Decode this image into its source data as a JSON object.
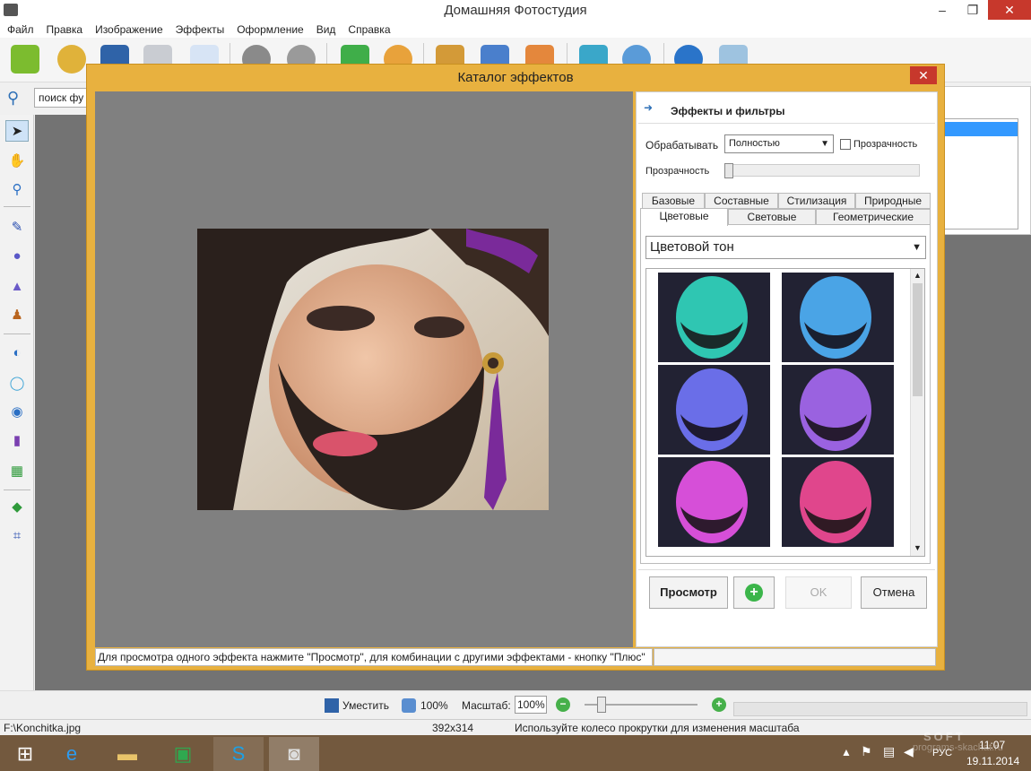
{
  "window": {
    "title": "Домашняя Фотостудия",
    "minimize": "–",
    "restore": "❐",
    "close": "✕"
  },
  "menu": [
    "Файл",
    "Правка",
    "Изображение",
    "Эффекты",
    "Оформление",
    "Вид",
    "Справка"
  ],
  "search": {
    "value": "поиск фу"
  },
  "dialog": {
    "title": "Каталог эффектов",
    "close": "✕",
    "hint": "Для просмотра одного эффекта нажмите \"Просмотр\", для комбинации с другими эффектами - кнопку \"Плюс\"",
    "panel": {
      "header": "Эффекты и фильтры",
      "process_label": "Обрабатывать",
      "process_value": "Полностью",
      "transparency_checkbox": "Прозрачность",
      "transparency_slider_label": "Прозрачность",
      "tabs_row1": [
        "Базовые",
        "Составные",
        "Стилизация",
        "Природные"
      ],
      "tabs_row2": [
        "Цветовые",
        "Световые",
        "Геометрические"
      ],
      "active_tab": "Цветовые",
      "effect_select": "Цветовой тон",
      "thumb_tints": [
        "#2fc6b2",
        "#4aa4e6",
        "#6a6ee8",
        "#9a62e0",
        "#d64fd8",
        "#e0468c"
      ]
    },
    "buttons": {
      "preview": "Просмотр",
      "plus": "+",
      "ok": "OK",
      "cancel": "Отмена"
    }
  },
  "bottom": {
    "fit": "Уместить",
    "zoom100": "100%",
    "scale_label": "Масштаб:",
    "scale_value": "100%",
    "zoom_out": "−",
    "zoom_in": "+"
  },
  "status": {
    "file": "F:\\Konchitka.jpg",
    "size": "392x314",
    "hint": "Используйте колесо прокрутки для изменения масштаба"
  },
  "tray": {
    "lang": "РУС",
    "time": "11:07",
    "date": "19.11.2014",
    "watermark": "SOFT",
    "watermark_url": "programs-skachat.ru"
  }
}
